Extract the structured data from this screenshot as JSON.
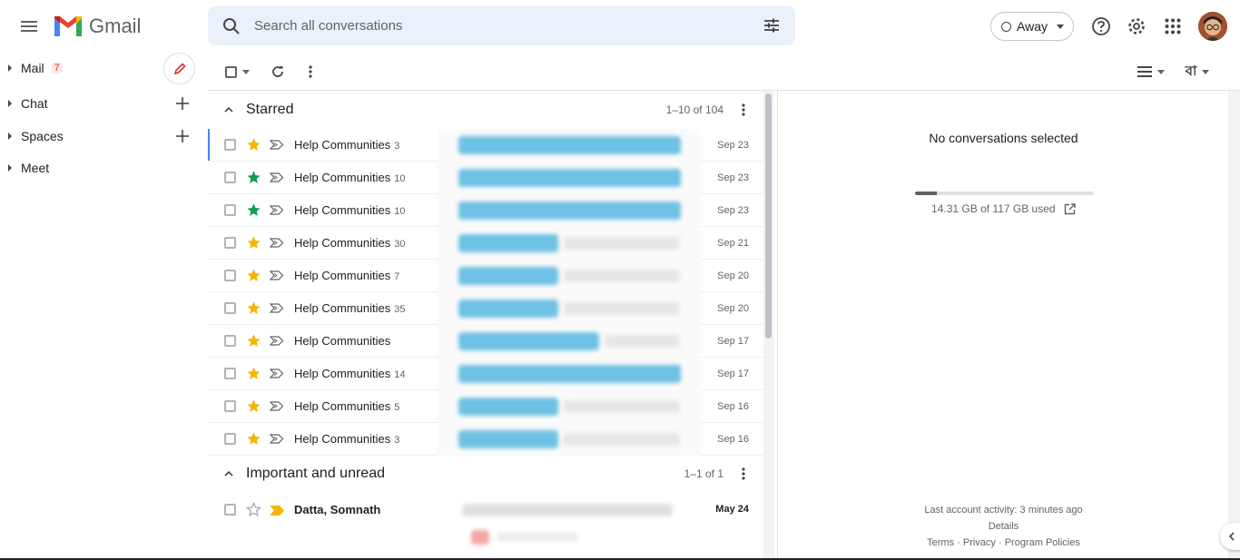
{
  "app": {
    "name": "Gmail"
  },
  "search": {
    "placeholder": "Search all conversations"
  },
  "status": {
    "label": "Away"
  },
  "sidebar": {
    "items": [
      {
        "label": "Mail",
        "badge": "7"
      },
      {
        "label": "Chat"
      },
      {
        "label": "Spaces"
      },
      {
        "label": "Meet"
      }
    ]
  },
  "sections": {
    "starred": {
      "title": "Starred",
      "count": "1–10 of 104",
      "rows": [
        {
          "sender": "Help Communities",
          "count": "3",
          "date": "Sep 23",
          "star": "yellow"
        },
        {
          "sender": "Help Communities",
          "count": "10",
          "date": "Sep 23",
          "star": "green"
        },
        {
          "sender": "Help Communities",
          "count": "10",
          "date": "Sep 23",
          "star": "green"
        },
        {
          "sender": "Help Communities",
          "count": "30",
          "date": "Sep 21",
          "star": "yellow"
        },
        {
          "sender": "Help Communities",
          "count": "7",
          "date": "Sep 20",
          "star": "yellow"
        },
        {
          "sender": "Help Communities",
          "count": "35",
          "date": "Sep 20",
          "star": "yellow"
        },
        {
          "sender": "Help Communities",
          "count": "",
          "date": "Sep 17",
          "star": "yellow"
        },
        {
          "sender": "Help Communities",
          "count": "14",
          "date": "Sep 17",
          "star": "yellow"
        },
        {
          "sender": "Help Communities",
          "count": "5",
          "date": "Sep 16",
          "star": "yellow"
        },
        {
          "sender": "Help Communities",
          "count": "3",
          "date": "Sep 16",
          "star": "yellow"
        }
      ]
    },
    "important": {
      "title": "Important and unread",
      "count": "1–1 of 1",
      "rows": [
        {
          "sender": "Datta, Somnath",
          "count": "",
          "date": "May 24",
          "star": "none"
        }
      ]
    }
  },
  "reading_pane": {
    "empty_message": "No conversations selected",
    "storage": {
      "text": "14.31 GB of 117 GB used",
      "used_fraction": 0.122
    },
    "last_activity": "Last account activity: 3 minutes ago",
    "details": "Details",
    "links": [
      "Terms",
      "Privacy",
      "Program Policies"
    ]
  },
  "colors": {
    "accent": "#4285f4",
    "star_yellow": "#f4b400",
    "star_green": "#0f9d58",
    "badge": "#d93025"
  },
  "language_button": "বা"
}
